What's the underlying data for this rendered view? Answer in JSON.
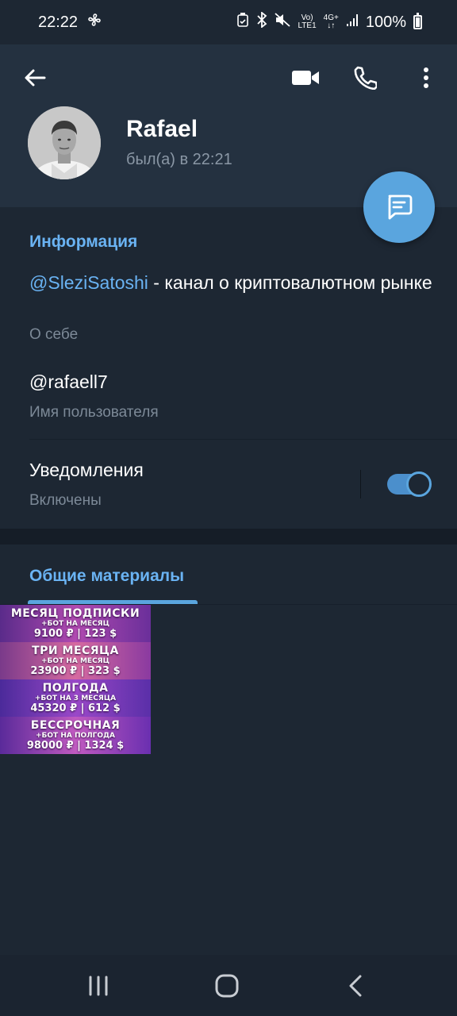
{
  "status_bar": {
    "time": "22:22",
    "network_top": "Vo)",
    "network_bottom": "LTE1",
    "data_type": "4G+",
    "battery": "100%"
  },
  "header": {
    "icons": [
      "back-arrow-icon",
      "video-call-icon",
      "phone-icon",
      "more-vertical-icon"
    ]
  },
  "profile": {
    "name": "Rafael",
    "status": "был(а) в 22:21"
  },
  "info": {
    "section_title": "Информация",
    "bio_mention": "@SleziSatoshi",
    "bio_text": " - канал о криптовалютном рынке",
    "bio_label": "О себе",
    "username": "@rafaell7",
    "username_label": "Имя пользователя",
    "notifications_title": "Уведомления",
    "notifications_status": "Включены",
    "notifications_enabled": true
  },
  "media": {
    "tab_label": "Общие материалы",
    "thumbnail_rows": [
      {
        "title": "МЕСЯЦ ПОДПИСКИ",
        "sub": "+БОТ НА МЕСЯЦ",
        "price": "9100 ₽ | 123 $"
      },
      {
        "title": "ТРИ МЕСЯЦА",
        "sub": "+БОТ НА МЕСЯЦ",
        "price": "23900 ₽ | 323 $"
      },
      {
        "title": "ПОЛГОДА",
        "sub": "+БОТ НА 3 МЕСЯЦА",
        "price": "45320 ₽ | 612 $"
      },
      {
        "title": "БЕССРОЧНАЯ",
        "sub": "+БОТ НА ПОЛГОДА",
        "price": "98000 ₽ | 1324 $"
      }
    ]
  },
  "colors": {
    "accent": "#6ab3f3",
    "fab": "#5aa5de",
    "header_bg": "#243140",
    "page_bg": "#1d2733"
  }
}
